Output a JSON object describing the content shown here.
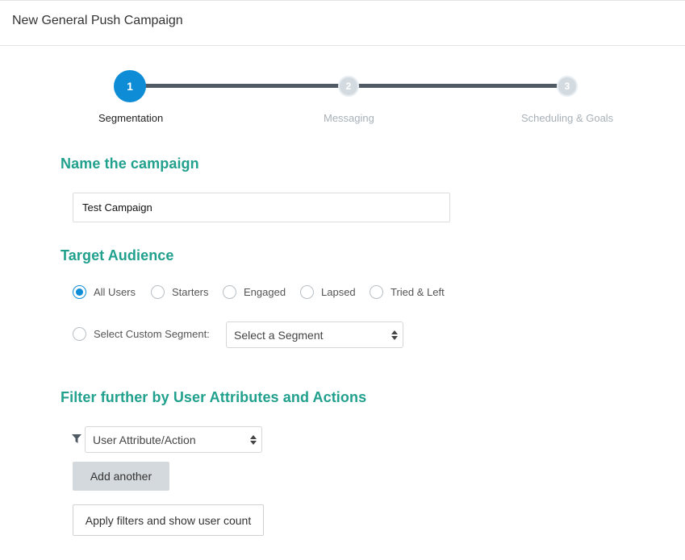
{
  "header": {
    "title": "New General Push Campaign"
  },
  "stepper": {
    "steps": [
      {
        "number": "1",
        "label": "Segmentation",
        "active": true
      },
      {
        "number": "2",
        "label": "Messaging",
        "active": false
      },
      {
        "number": "3",
        "label": "Scheduling & Goals",
        "active": false
      }
    ]
  },
  "name_section": {
    "title": "Name the campaign",
    "input_value": "Test Campaign"
  },
  "audience_section": {
    "title": "Target Audience",
    "options": [
      {
        "label": "All Users",
        "checked": true
      },
      {
        "label": "Starters",
        "checked": false
      },
      {
        "label": "Engaged",
        "checked": false
      },
      {
        "label": "Lapsed",
        "checked": false
      },
      {
        "label": "Tried & Left",
        "checked": false
      }
    ],
    "custom_segment": {
      "label": "Select Custom Segment:",
      "checked": false,
      "select_value": "Select a Segment"
    }
  },
  "filter_section": {
    "title": "Filter further by User Attributes and Actions",
    "select_value": "User Attribute/Action",
    "add_another_label": "Add another",
    "apply_label": "Apply filters and show user count"
  },
  "colors": {
    "accent": "#0e8dd6",
    "section_title": "#21a08d",
    "stepper_line": "#505a65",
    "inactive_step": "#d3dbe1"
  }
}
